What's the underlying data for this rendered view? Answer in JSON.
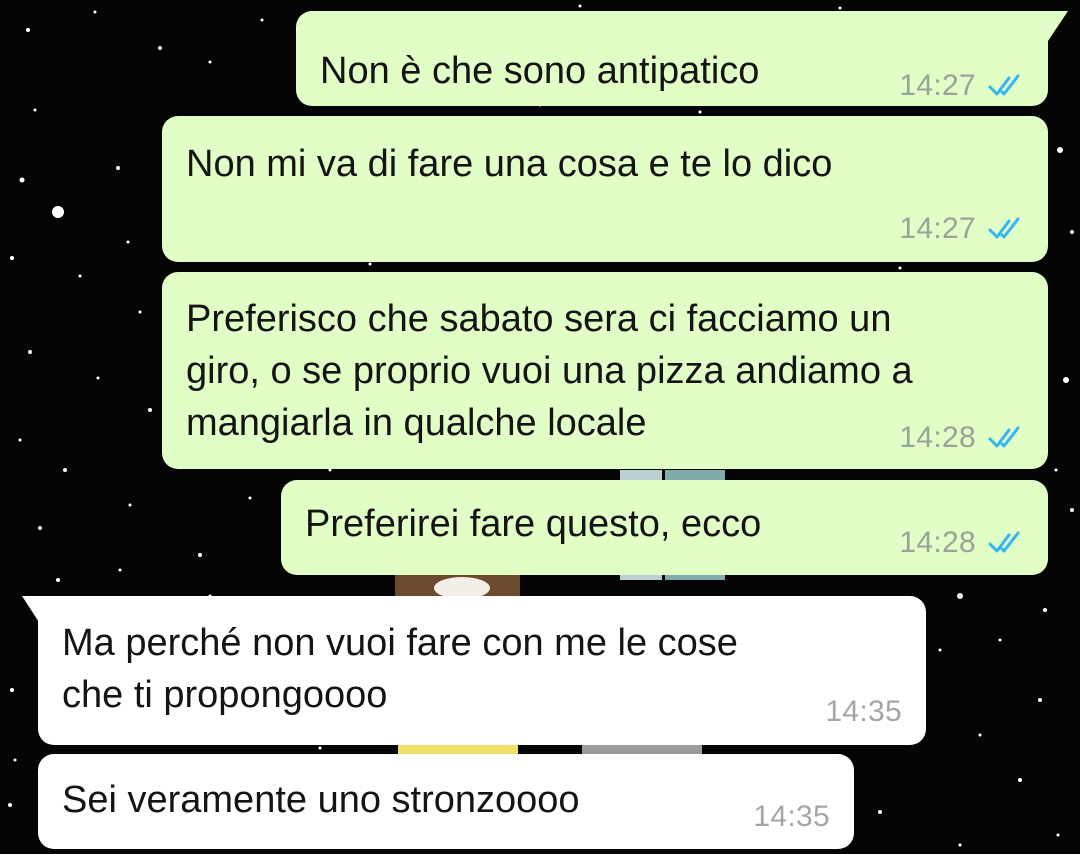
{
  "colors": {
    "outgoing_bubble": "#e1fec6",
    "incoming_bubble": "#ffffff",
    "timestamp": "#9aa39a",
    "read_ticks": "#34b7f1",
    "background": "#050505"
  },
  "messages": [
    {
      "direction": "outgoing",
      "text": "Non è che sono antipatico",
      "time": "14:27",
      "status_icon": "double-check-read-icon"
    },
    {
      "direction": "outgoing",
      "text": "Non mi va di fare una cosa e te lo dico",
      "time": "14:27",
      "status_icon": "double-check-read-icon"
    },
    {
      "direction": "outgoing",
      "lines": [
        "Preferisco che sabato sera ci facciamo un",
        "giro, o se proprio vuoi una pizza andiamo a",
        "mangiarla in qualche locale"
      ],
      "time": "14:28",
      "status_icon": "double-check-read-icon"
    },
    {
      "direction": "outgoing",
      "text": "Preferirei fare questo, ecco",
      "time": "14:28",
      "status_icon": "double-check-read-icon"
    },
    {
      "direction": "incoming",
      "lines": [
        "Ma perché non vuoi fare con me le cose",
        "che ti propongoooo"
      ],
      "time": "14:35"
    },
    {
      "direction": "incoming",
      "text": "Sei veramente uno stronzoooo",
      "time": "14:35"
    }
  ]
}
